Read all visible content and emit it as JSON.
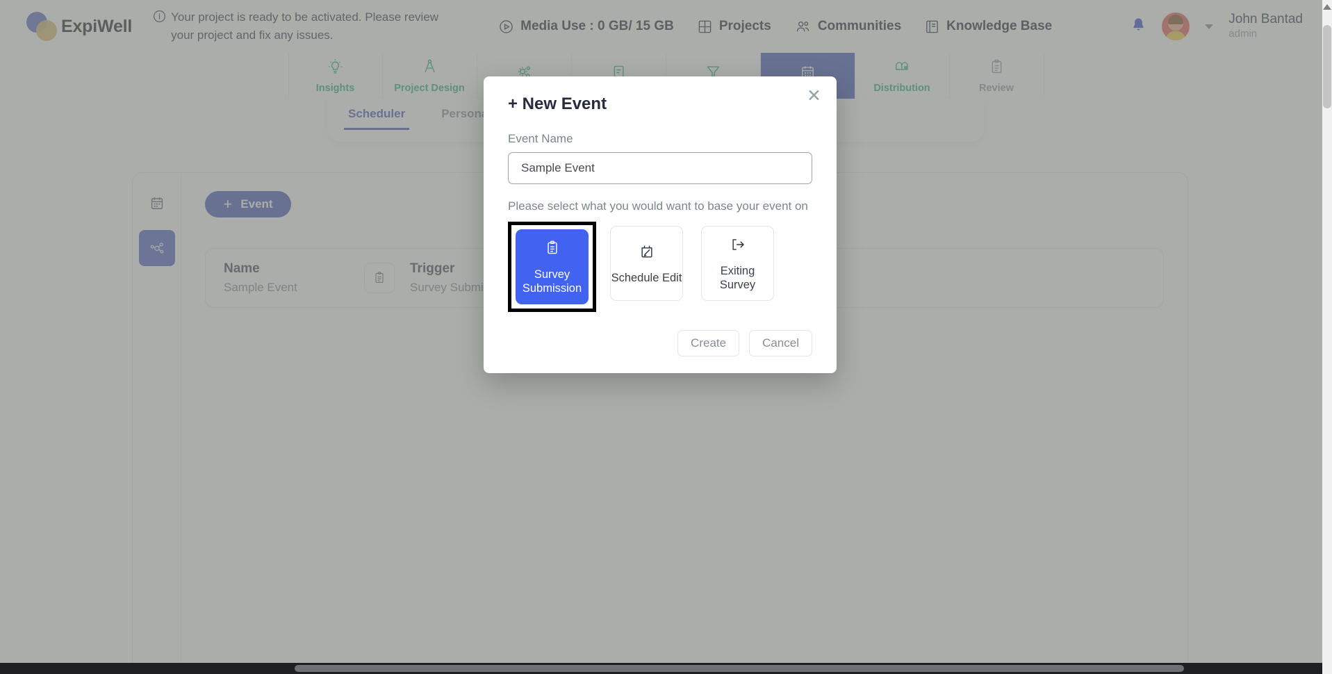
{
  "brand": {
    "name": "ExpiWell"
  },
  "notice": {
    "icon": "info-icon",
    "text": "Your project is ready to be activated. Please review your project and fix any issues."
  },
  "topnav": {
    "items": [
      {
        "label": "Media Use : 0 GB/ 15 GB",
        "icon": "play-circle-icon"
      },
      {
        "label": "Projects",
        "icon": "grid-icon"
      },
      {
        "label": "Communities",
        "icon": "people-icon"
      },
      {
        "label": "Knowledge Base",
        "icon": "book-icon"
      }
    ],
    "notification_icon": "bell-icon",
    "user": {
      "name": "John Bantad",
      "role": "admin",
      "avatar": "user-avatar",
      "caret": "chevron-down-icon"
    }
  },
  "modules": [
    {
      "label": "Insights",
      "icon": "lightbulb-icon",
      "state": "green"
    },
    {
      "label": "Project Design",
      "icon": "compass-icon",
      "state": "green"
    },
    {
      "label": "",
      "icon": "gears-icon",
      "state": "green"
    },
    {
      "label": "",
      "icon": "document-icon",
      "state": "green"
    },
    {
      "label": "",
      "icon": "funnel-icon",
      "state": "green"
    },
    {
      "label": "",
      "icon": "calendar-icon",
      "state": "active"
    },
    {
      "label": "Distribution",
      "icon": "mailbox-icon",
      "state": "green"
    },
    {
      "label": "Review",
      "icon": "clipboard-list-icon",
      "state": "gray"
    }
  ],
  "panel_tabs": [
    {
      "label": "Scheduler",
      "active": true
    },
    {
      "label": "Personal",
      "active": false
    }
  ],
  "board": {
    "rail": [
      {
        "icon": "calendar-icon",
        "selected": false
      },
      {
        "icon": "network-graph-icon",
        "selected": true,
        "highlighted": true
      }
    ],
    "add_event_button": {
      "label": "Event",
      "plus": "+"
    },
    "table": {
      "columns": [
        {
          "header": "Name",
          "value": "Sample Event"
        },
        {
          "header": "Trigger",
          "value": "Survey Submission"
        }
      ],
      "row_icon": "clipboard-list-icon"
    }
  },
  "modal": {
    "title": "+ New Event",
    "close_icon": "close-icon",
    "field": {
      "label": "Event Name",
      "value": "Sample Event",
      "placeholder": "Event Name"
    },
    "hint": "Please select what you would want to base your event on",
    "options": [
      {
        "label": "Survey Submission",
        "icon": "clipboard-list-icon",
        "selected": true,
        "highlighted": true
      },
      {
        "label": "Schedule Edit",
        "icon": "calendar-edit-icon",
        "selected": false,
        "highlighted": false
      },
      {
        "label": "Exiting Survey",
        "icon": "exit-arrow-icon",
        "selected": false,
        "highlighted": false
      }
    ],
    "buttons": [
      {
        "label": "Create",
        "name": "create-button"
      },
      {
        "label": "Cancel",
        "name": "cancel-button"
      }
    ]
  },
  "colors": {
    "accent_blue": "#4f62bd",
    "option_blue": "#4263f0",
    "green": "#36b37e",
    "gray_text": "#8b9099"
  }
}
